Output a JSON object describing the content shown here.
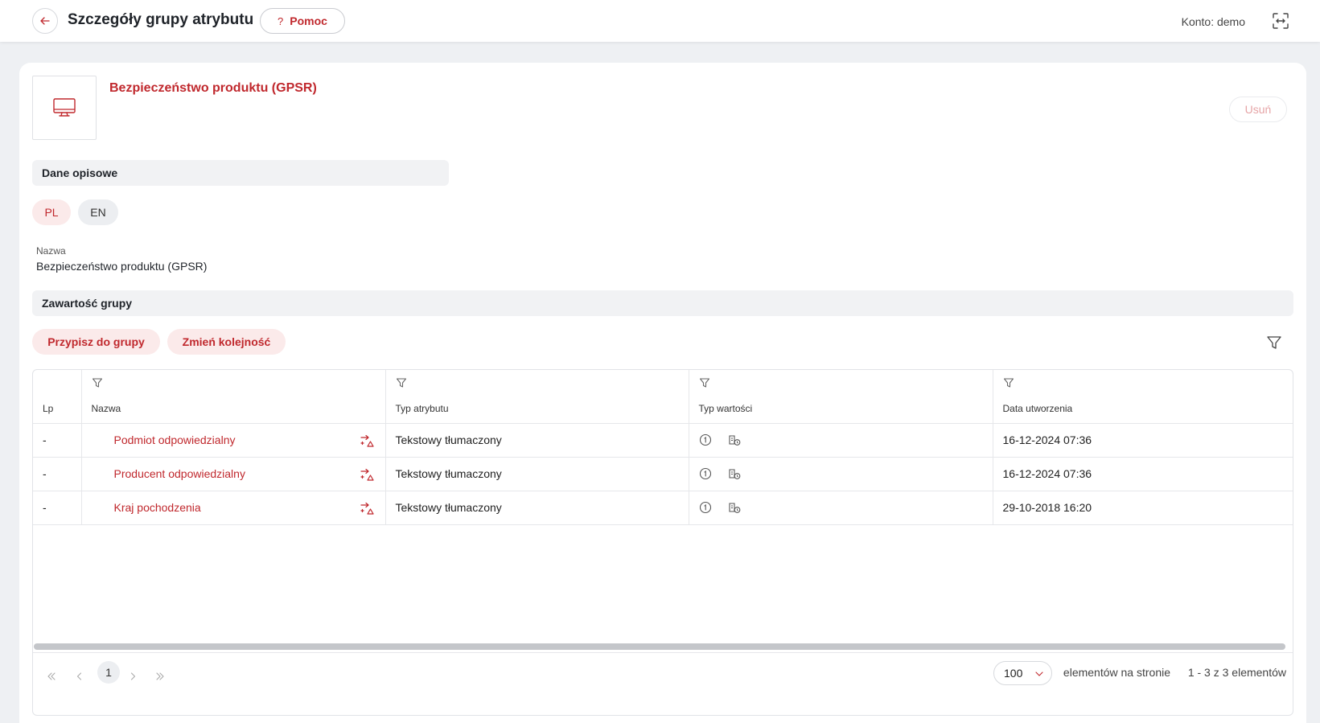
{
  "header": {
    "title": "Szczegóły grupy atrybutu",
    "help_label": "Pomoc",
    "help_symbol": "?",
    "account_label": "Konto: demo"
  },
  "group": {
    "name": "Bezpieczeństwo produktu (GPSR)",
    "delete_label": "Usuń"
  },
  "descriptive": {
    "section_title": "Dane opisowe",
    "languages": [
      "PL",
      "EN"
    ],
    "active_language": "PL",
    "field_label": "Nazwa",
    "field_value": "Bezpieczeństwo produktu (GPSR)"
  },
  "contents": {
    "section_title": "Zawartość grupy",
    "assign_label": "Przypisz do grupy",
    "reorder_label": "Zmień kolejność",
    "columns": [
      "Lp",
      "Nazwa",
      "Typ atrybutu",
      "Typ wartości",
      "Data utworzenia"
    ],
    "rows": [
      {
        "lp": "-",
        "name": "Podmiot odpowiedzialny",
        "type": "Tekstowy tłumaczony",
        "created": "16-12-2024 07:36"
      },
      {
        "lp": "-",
        "name": "Producent odpowiedzialny",
        "type": "Tekstowy tłumaczony",
        "created": "16-12-2024 07:36"
      },
      {
        "lp": "-",
        "name": "Kraj pochodzenia",
        "type": "Tekstowy tłumaczony",
        "created": "29-10-2018 16:20"
      }
    ]
  },
  "pagination": {
    "current_page": "1",
    "page_size": "100",
    "page_size_label": "elementów na stronie",
    "range_text": "1 - 3 z 3 elementów"
  },
  "colors": {
    "accent": "#c0282d",
    "accent_soft": "#fbeaea"
  }
}
